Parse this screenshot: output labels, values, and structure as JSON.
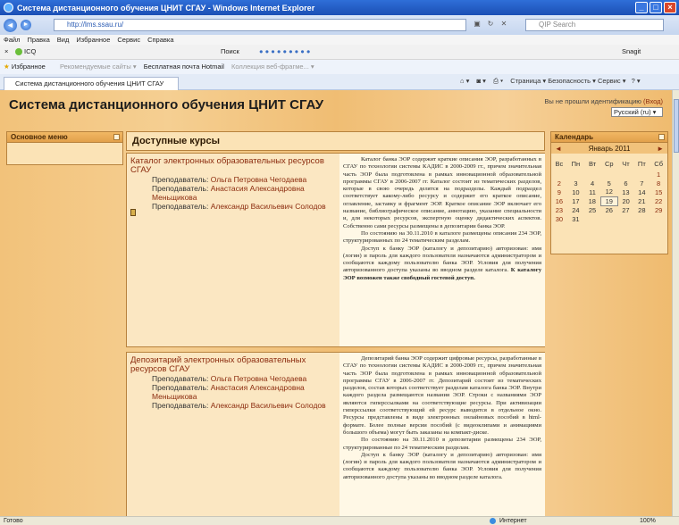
{
  "window": {
    "title": "Система дистанционного обучения ЦНИТ СГАУ - Windows Internet Explorer",
    "min": "_",
    "max": "□",
    "close": "×"
  },
  "address": {
    "url": "http://lms.ssau.ru/",
    "search_placeholder": "QIP Search"
  },
  "menu": [
    "Файл",
    "Правка",
    "Вид",
    "Избранное",
    "Сервис",
    "Справка"
  ],
  "toolbar": {
    "close": "×",
    "icq": "ICQ",
    "search": "Поиск",
    "snagit": "Snagit"
  },
  "favorites": {
    "label": "Избранное",
    "items": [
      "Рекомендуемые сайты ▾",
      "Бесплатная почта Hotmail",
      "Коллекция веб-фрагме... ▾"
    ]
  },
  "tab": {
    "title": "Система дистанционного обучения ЦНИТ СГАУ",
    "tools": "Страница ▾   Безопасность ▾   Сервис ▾"
  },
  "page": {
    "site_title": "Система дистанционного обучения ЦНИТ СГАУ",
    "login_text": "Вы не прошли идентификацию",
    "login_link": "(Вход)",
    "language": "Русский (ru) ▾"
  },
  "main_menu": {
    "title": "Основное меню"
  },
  "courses": {
    "header": "Доступные курсы",
    "teacher_label": "Преподаватель:",
    "items": [
      {
        "name": "Каталог электронных образовательных ресурсов СГАУ",
        "teachers": [
          "Ольга Петровна Чегодаева",
          "Анастасия Александровна Меньщикова",
          "Александр Васильевич Солодов"
        ],
        "summary_p1": "Каталог банка ЭОР содержит краткие описания ЭОР, разработанных в СГАУ по технологии системы КАДИС в 2000-2009 гг., причем значительная часть ЭОР была подготовлена в рамках инновационной образовательной программы СГАУ в 2006-2007 гг. Каталог состоит из тематических разделов, которые в свою очередь делятся на подразделы. Каждый подраздел соответствует какому-либо ресурсу и содержит его краткое описание, оглавление, заставку и фрагмент ЭОР. Краткое описание ЭОР включает его название, библиографическое описание, аннотацию, указание специальности и, для некоторых ресурсов, экспертную оценку дидактических аспектов. Собственно сами ресурсы размещены в депозитарии банка ЭОР.",
        "summary_p2": "По состоянию на 30.11.2010 в каталоге размещены описания 234 ЭОР, структурированных по 24 тематическим разделам.",
        "summary_p3": "Доступ к банку ЭОР (каталогу и депозитарию) авторизован: имя (логин) и пароль для каждого пользователя назначаются администратором и сообщаются каждому пользователю банка ЭОР. Условия для получения авторизованного доступа указаны во вводном разделе каталога.",
        "summary_bold": "К каталогу ЭОР возможен также свободный гостевой доступ."
      },
      {
        "name": "Депозитарий электронных образовательных ресурсов СГАУ",
        "teachers": [
          "Ольга Петровна Чегодаева",
          "Анастасия Александровна Меньщикова",
          "Александр Васильевич Солодов"
        ],
        "summary_p1": "Депозитарий банка ЭОР содержит цифровые ресурсы, разработанные в СГАУ по технологии системы КАДИС в 2000-2009 гг., причем значительная часть ЭОР была подготовлена в рамках инновационной образовательной программы СГАУ в 2006-2007 гг. Депозитарий состоит из тематических разделов, состав которых соответствует разделам каталога банка ЭОР. Внутри каждого раздела размещаются названия ЭОР. Строки с названиями ЭОР являются гиперссылками на соответствующие ресурсы. При активизации гиперссылки соответствующий ей ресурс выводится в отдельное окно. Ресурсы представлены в виде электронных онлайновых пособий в html-формате. Более полные версии пособий (с видеоклипами и анимациями большого объема) могут быть заказаны на компакт-диске.",
        "summary_p2": "По состоянию на 30.11.2010 в депозитарии размещены 234 ЭОР, структурированные по 24 тематическим разделам.",
        "summary_p3": "Доступ к банку ЭОР (каталогу и депозитарию) авторизован: имя (логин) и пароль для каждого пользователя назначаются администратором и сообщаются каждому пользователю банка ЭОР. Условия для получения авторизованного доступа указаны во вводном разделе каталога."
      }
    ]
  },
  "calendar": {
    "title": "Календарь",
    "month": "Январь 2011",
    "prev": "◄",
    "next": "►",
    "weekdays": [
      "Вс",
      "Пн",
      "Вт",
      "Ср",
      "Чт",
      "Пт",
      "Сб"
    ],
    "weeks": [
      [
        "",
        "",
        "",
        "",
        "",
        "",
        "1"
      ],
      [
        "2",
        "3",
        "4",
        "5",
        "6",
        "7",
        "8"
      ],
      [
        "9",
        "10",
        "11",
        "12",
        "13",
        "14",
        "15"
      ],
      [
        "16",
        "17",
        "18",
        "19",
        "20",
        "21",
        "22"
      ],
      [
        "23",
        "24",
        "25",
        "26",
        "27",
        "28",
        "29"
      ],
      [
        "30",
        "31",
        "",
        "",
        "",
        "",
        ""
      ]
    ],
    "today": "19"
  },
  "status": {
    "left": "Готово",
    "zone": "Интернет",
    "zoom": "100%"
  }
}
